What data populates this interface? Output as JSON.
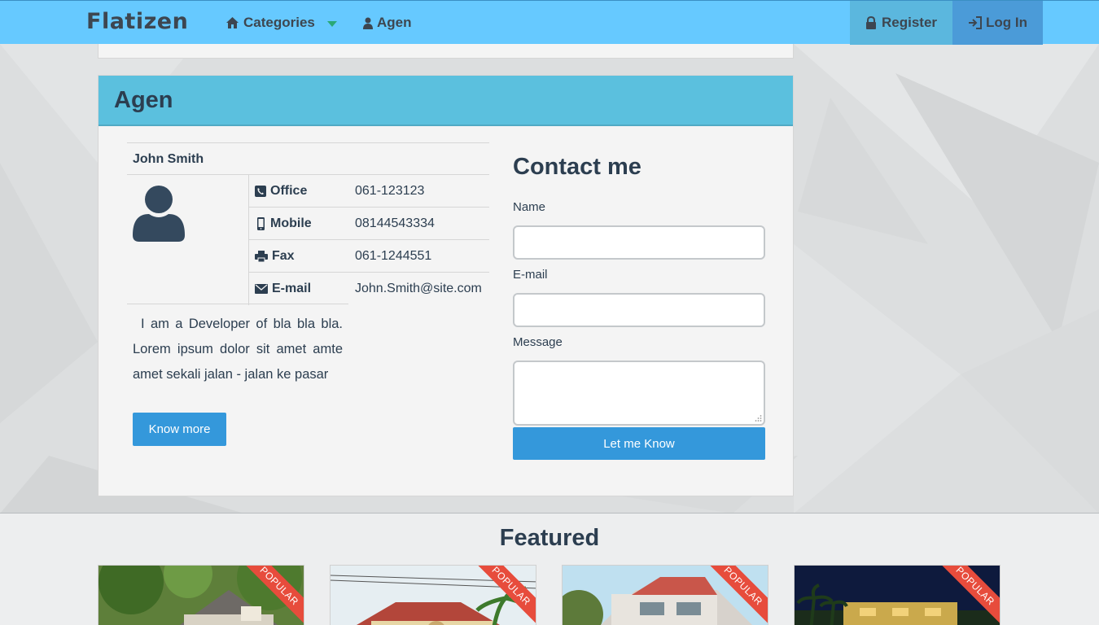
{
  "navbar": {
    "brand": "Flatizen",
    "categories_label": "Categories",
    "agen_label": "Agen",
    "register_label": "Register",
    "login_label": "Log In"
  },
  "panel": {
    "title": "Agen",
    "agent_name": "John Smith",
    "rows": [
      {
        "icon": "phone-icon",
        "label": "Office",
        "value": "061-123123"
      },
      {
        "icon": "mobile-icon",
        "label": "Mobile",
        "value": "08144543334"
      },
      {
        "icon": "printer-icon",
        "label": "Fax",
        "value": "061-1244551"
      },
      {
        "icon": "envelope-icon",
        "label": "E-mail",
        "value": "John.Smith@site.com"
      }
    ],
    "bio": "I am a Developer of bla bla bla. Lorem ipsum dolor sit amet amte amet sekali jalan - jalan ke pasar",
    "know_more_label": "Know more"
  },
  "contact": {
    "title": "Contact me",
    "name_label": "Name",
    "email_label": "E-mail",
    "message_label": "Message",
    "name_value": "",
    "email_value": "",
    "message_value": "",
    "submit_label": "Let me Know"
  },
  "featured": {
    "title": "Featured",
    "cards": [
      {
        "badge": "POPULAR"
      },
      {
        "badge": "POPULAR"
      },
      {
        "badge": "POPULAR"
      },
      {
        "badge": "POPULAR"
      }
    ]
  },
  "colors": {
    "navbar": "#66c9ff",
    "panel_header": "#5bc0de",
    "primary_button": "#3498db",
    "ribbon": "#e74c3c",
    "register_bg": "#5bb7de",
    "login_bg": "#4b9bd8"
  }
}
